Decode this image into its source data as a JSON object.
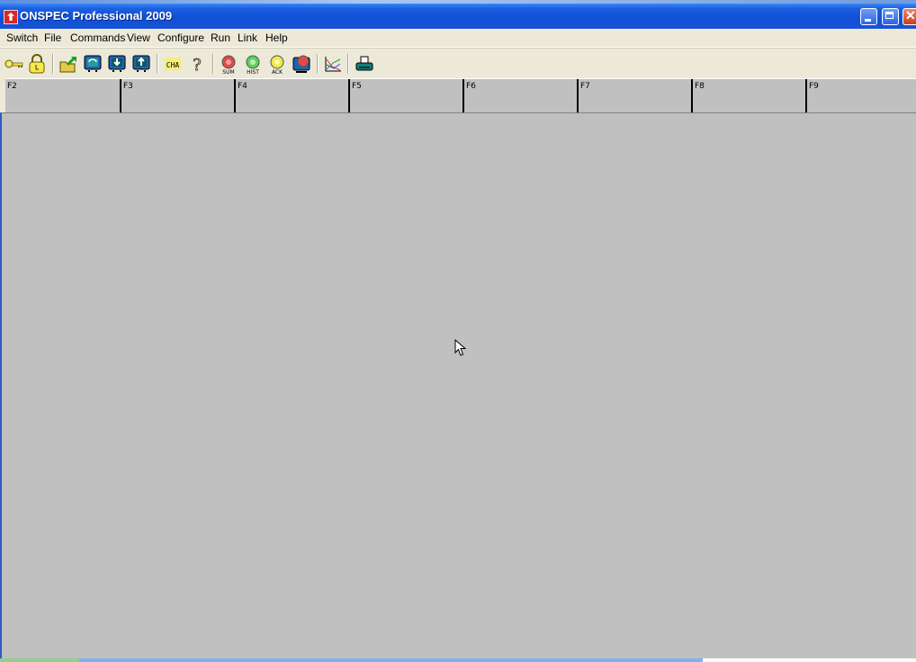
{
  "window": {
    "title": "ONSPEC Professional 2009",
    "controls": [
      "minimize",
      "maximize",
      "close"
    ]
  },
  "menubar": {
    "items": [
      {
        "label": "Switch"
      },
      {
        "label": "File"
      },
      {
        "label": "Commands"
      },
      {
        "label": "View"
      },
      {
        "label": "Configure"
      },
      {
        "label": "Run"
      },
      {
        "label": "Link"
      },
      {
        "label": "Help"
      }
    ]
  },
  "toolbar": {
    "tools": [
      {
        "name": "key-icon"
      },
      {
        "name": "lock-icon"
      },
      {
        "name": "open-folder-icon"
      },
      {
        "name": "monitor-refresh-icon"
      },
      {
        "name": "monitor-download-icon"
      },
      {
        "name": "monitor-upload-icon"
      },
      {
        "name": "cha-icon",
        "label": "CHA"
      },
      {
        "name": "help-icon",
        "label": "?"
      },
      {
        "name": "sum-alarm-icon",
        "label": "SUM"
      },
      {
        "name": "hist-alarm-icon",
        "label": "HIST"
      },
      {
        "name": "ack-alarm-icon",
        "label": "ACK"
      },
      {
        "name": "alarm-monitor-icon"
      },
      {
        "name": "trend-chart-icon"
      },
      {
        "name": "printer-icon"
      }
    ]
  },
  "fkeys": [
    {
      "label": "F2"
    },
    {
      "label": "F3"
    },
    {
      "label": "F4"
    },
    {
      "label": "F5"
    },
    {
      "label": "F6"
    },
    {
      "label": "F7"
    },
    {
      "label": "F8"
    },
    {
      "label": "F9"
    }
  ]
}
